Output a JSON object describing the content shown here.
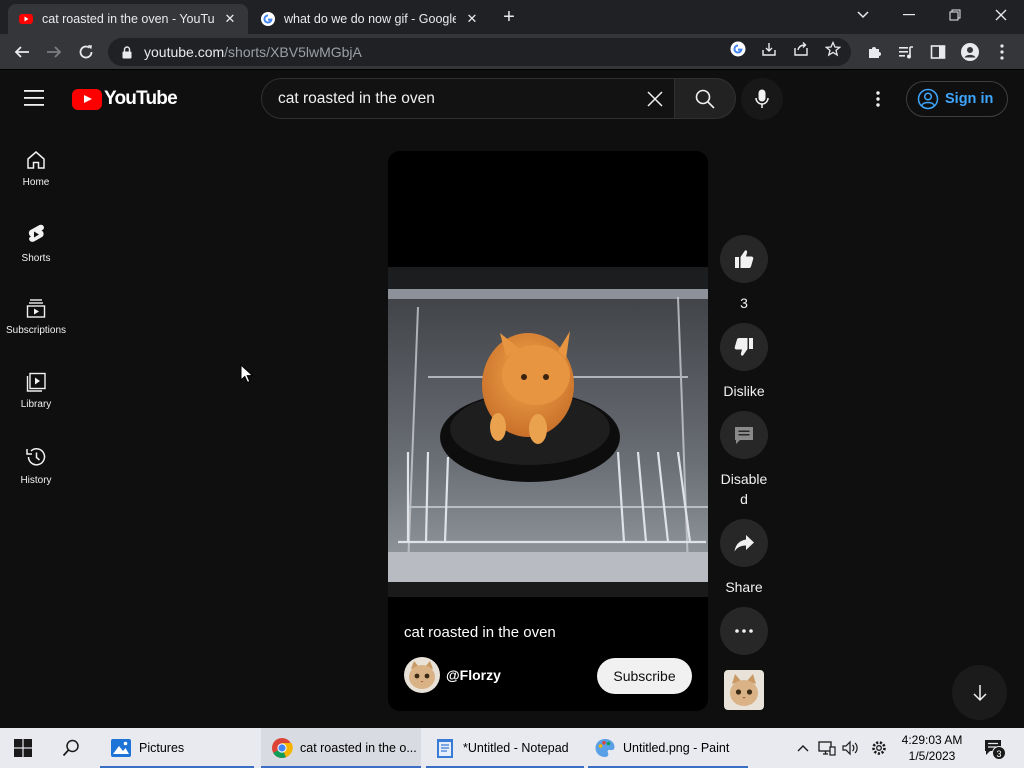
{
  "browser": {
    "tabs": [
      {
        "title": "cat roasted in the oven - YouTube",
        "active": true
      },
      {
        "title": "what do we do now gif - Google",
        "active": false
      }
    ],
    "url_host": "youtube.com",
    "url_path": "/shorts/XBV5lwMGbjA"
  },
  "youtube": {
    "logo_text": "YouTube",
    "search_query": "cat roasted in the oven",
    "signin_label": "Sign in",
    "sidebar": [
      {
        "label": "Home",
        "icon": "home-icon"
      },
      {
        "label": "Shorts",
        "icon": "shorts-icon"
      },
      {
        "label": "Subscriptions",
        "icon": "subscriptions-icon"
      },
      {
        "label": "Library",
        "icon": "library-icon"
      },
      {
        "label": "History",
        "icon": "history-icon"
      }
    ],
    "short": {
      "title": "cat roasted in the oven",
      "channel": "@Florzy",
      "subscribe_label": "Subscribe"
    },
    "actions": {
      "like_count": "3",
      "dislike_label": "Dislike",
      "comments_label": "Disabled",
      "share_label": "Share"
    }
  },
  "taskbar": {
    "items": [
      {
        "label": "Pictures",
        "icon": "photos-icon"
      },
      {
        "label": "cat roasted in the o...",
        "icon": "chrome-icon"
      },
      {
        "label": "*Untitled - Notepad",
        "icon": "notepad-icon"
      },
      {
        "label": "Untitled.png - Paint",
        "icon": "paint-icon"
      }
    ],
    "time": "4:29:03 AM",
    "date": "1/5/2023",
    "notification_count": "3"
  },
  "colors": {
    "youtube_red": "#ff0000",
    "signin_blue": "#3ea6ff",
    "page_bg": "#0f0f0f"
  }
}
